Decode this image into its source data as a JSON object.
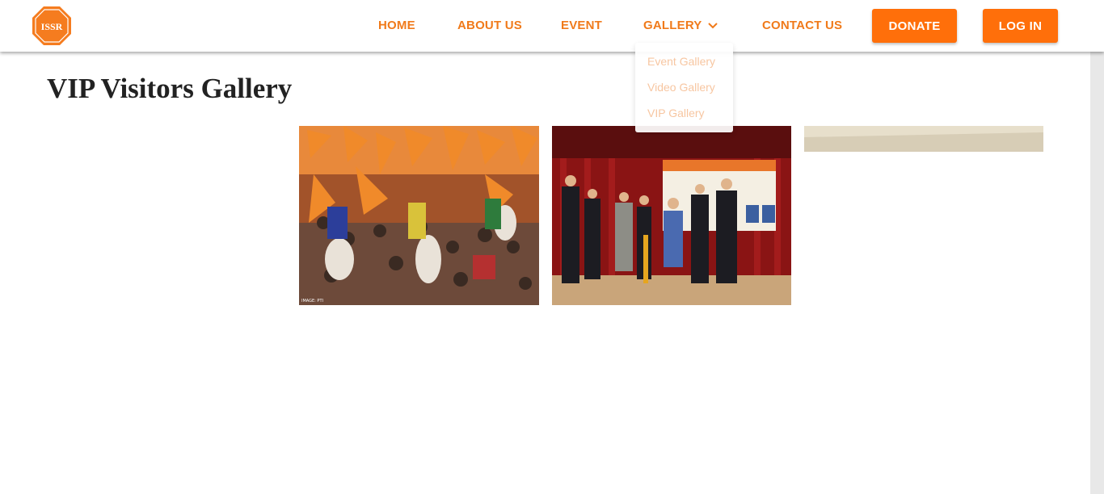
{
  "brand": {
    "logo_text": "ISSR"
  },
  "nav": {
    "home": "HOME",
    "about": "ABOUT US",
    "event": "EVENT",
    "gallery": "GALLERY",
    "contact": "CONTACT US",
    "donate": "DONATE",
    "login": "LOG IN"
  },
  "gallery_menu": {
    "items": [
      "Event Gallery",
      "Video Gallery",
      "VIP Gallery"
    ]
  },
  "page": {
    "title": "VIP Visitors Gallery"
  },
  "photos": {
    "watermark": "IMAGE: PTI"
  },
  "colors": {
    "accent": "#ff6f0a",
    "link": "#f07a1a",
    "dropdown_text": "#f7c29a"
  }
}
